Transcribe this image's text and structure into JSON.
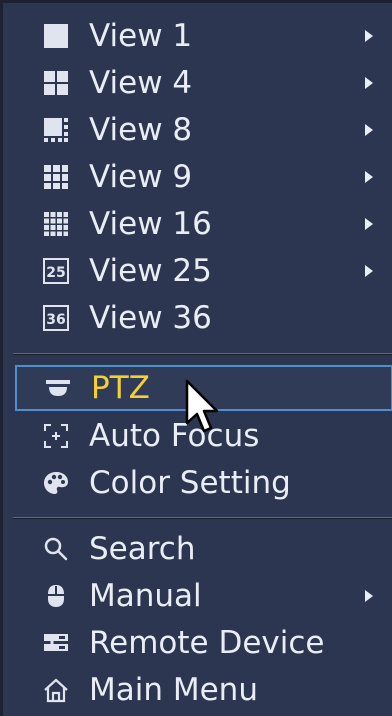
{
  "menu": {
    "items": [
      {
        "label": "View 1",
        "icon": "single-view-icon",
        "has_submenu": true
      },
      {
        "label": "View 4",
        "icon": "quad-view-icon",
        "has_submenu": true
      },
      {
        "label": "View 8",
        "icon": "eight-view-icon",
        "has_submenu": true
      },
      {
        "label": "View 9",
        "icon": "nine-view-icon",
        "has_submenu": true
      },
      {
        "label": "View 16",
        "icon": "sixteen-view-icon",
        "has_submenu": true
      },
      {
        "label": "View 25",
        "icon": "view-25-icon",
        "badge": "25",
        "has_submenu": true
      },
      {
        "label": "View 36",
        "icon": "view-36-icon",
        "badge": "36",
        "has_submenu": false
      },
      {
        "label": "PTZ",
        "icon": "ptz-dome-icon",
        "has_submenu": false,
        "selected": true
      },
      {
        "label": "Auto Focus",
        "icon": "auto-focus-icon",
        "has_submenu": false
      },
      {
        "label": "Color Setting",
        "icon": "palette-icon",
        "has_submenu": false
      },
      {
        "label": "Search",
        "icon": "search-icon",
        "has_submenu": false
      },
      {
        "label": "Manual",
        "icon": "mouse-icon",
        "has_submenu": true
      },
      {
        "label": "Remote Device",
        "icon": "remote-device-icon",
        "has_submenu": false
      },
      {
        "label": "Main Menu",
        "icon": "home-icon",
        "has_submenu": false
      }
    ]
  },
  "colors": {
    "menu_bg": "#2c3650",
    "text": "#e9edf6",
    "selected_text": "#f4cf36",
    "selected_border": "#4f8fd0"
  }
}
